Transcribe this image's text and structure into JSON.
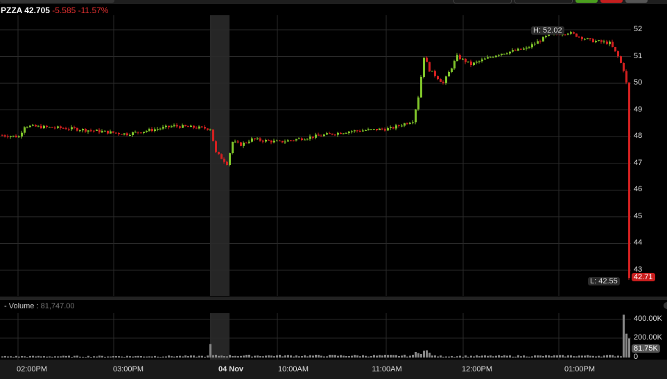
{
  "header": {
    "symbol": "PZZA",
    "price": "42.705",
    "change": "-5.585",
    "change_pct": "-11.57%"
  },
  "volume_header": {
    "label": "- Volume :",
    "value": "81,747.00"
  },
  "colors": {
    "up": "#7fc42a",
    "down": "#d42020",
    "grid": "#2a2a2a",
    "band": "#262626",
    "last_tag": "#c81e1e",
    "vol": "#888888"
  },
  "chart_data": {
    "type": "candlestick",
    "price_axis": {
      "ylim": [
        42.4,
        52.3
      ],
      "ticks": [
        "52",
        "51",
        "50",
        "49",
        "48",
        "47",
        "46",
        "45",
        "44",
        "43"
      ]
    },
    "x_ticks": [
      "02:00PM",
      "03:00PM",
      "04 Nov",
      "10:00AM",
      "11:00AM",
      "12:00PM",
      "01:00PM"
    ],
    "high_label": "H: 52.02",
    "low_label": "L: 42.55",
    "last_label": "42.71",
    "price_keypoints_bar_close": [
      [
        0,
        48.05
      ],
      [
        6,
        48.0
      ],
      [
        8,
        48.4
      ],
      [
        25,
        48.3
      ],
      [
        45,
        48.1
      ],
      [
        62,
        48.4
      ],
      [
        75,
        48.3
      ],
      [
        77,
        47.4
      ],
      [
        81,
        47.0
      ],
      [
        83,
        47.8
      ],
      [
        86,
        47.7
      ],
      [
        90,
        47.9
      ],
      [
        100,
        47.8
      ],
      [
        112,
        48.0
      ],
      [
        125,
        48.2
      ],
      [
        140,
        48.3
      ],
      [
        148,
        48.6
      ],
      [
        150,
        49.5
      ],
      [
        152,
        51.0
      ],
      [
        154,
        50.5
      ],
      [
        159,
        50.0
      ],
      [
        164,
        51.0
      ],
      [
        169,
        50.7
      ],
      [
        179,
        51.1
      ],
      [
        189,
        51.3
      ],
      [
        197,
        51.8
      ],
      [
        204,
        51.9
      ],
      [
        212,
        51.6
      ],
      [
        219,
        51.5
      ],
      [
        222,
        51.0
      ],
      [
        224,
        50.5
      ],
      [
        225,
        50.0
      ],
      [
        226,
        45.0
      ],
      [
        226.5,
        42.71
      ]
    ],
    "volume_axis": {
      "ylim": [
        0,
        440000
      ],
      "ticks": [
        "400.00K",
        "200.00K",
        "0"
      ],
      "last_label": "81.75K"
    },
    "volume_keypoints_bar": [
      [
        0,
        12000
      ],
      [
        74,
        15000
      ],
      [
        75,
        120000
      ],
      [
        76,
        20000
      ],
      [
        148,
        20000
      ],
      [
        150,
        80000
      ],
      [
        153,
        60000
      ],
      [
        156,
        15000
      ],
      [
        223,
        20000
      ],
      [
        224,
        450000
      ],
      [
        225,
        250000
      ],
      [
        226,
        200000
      ]
    ]
  }
}
